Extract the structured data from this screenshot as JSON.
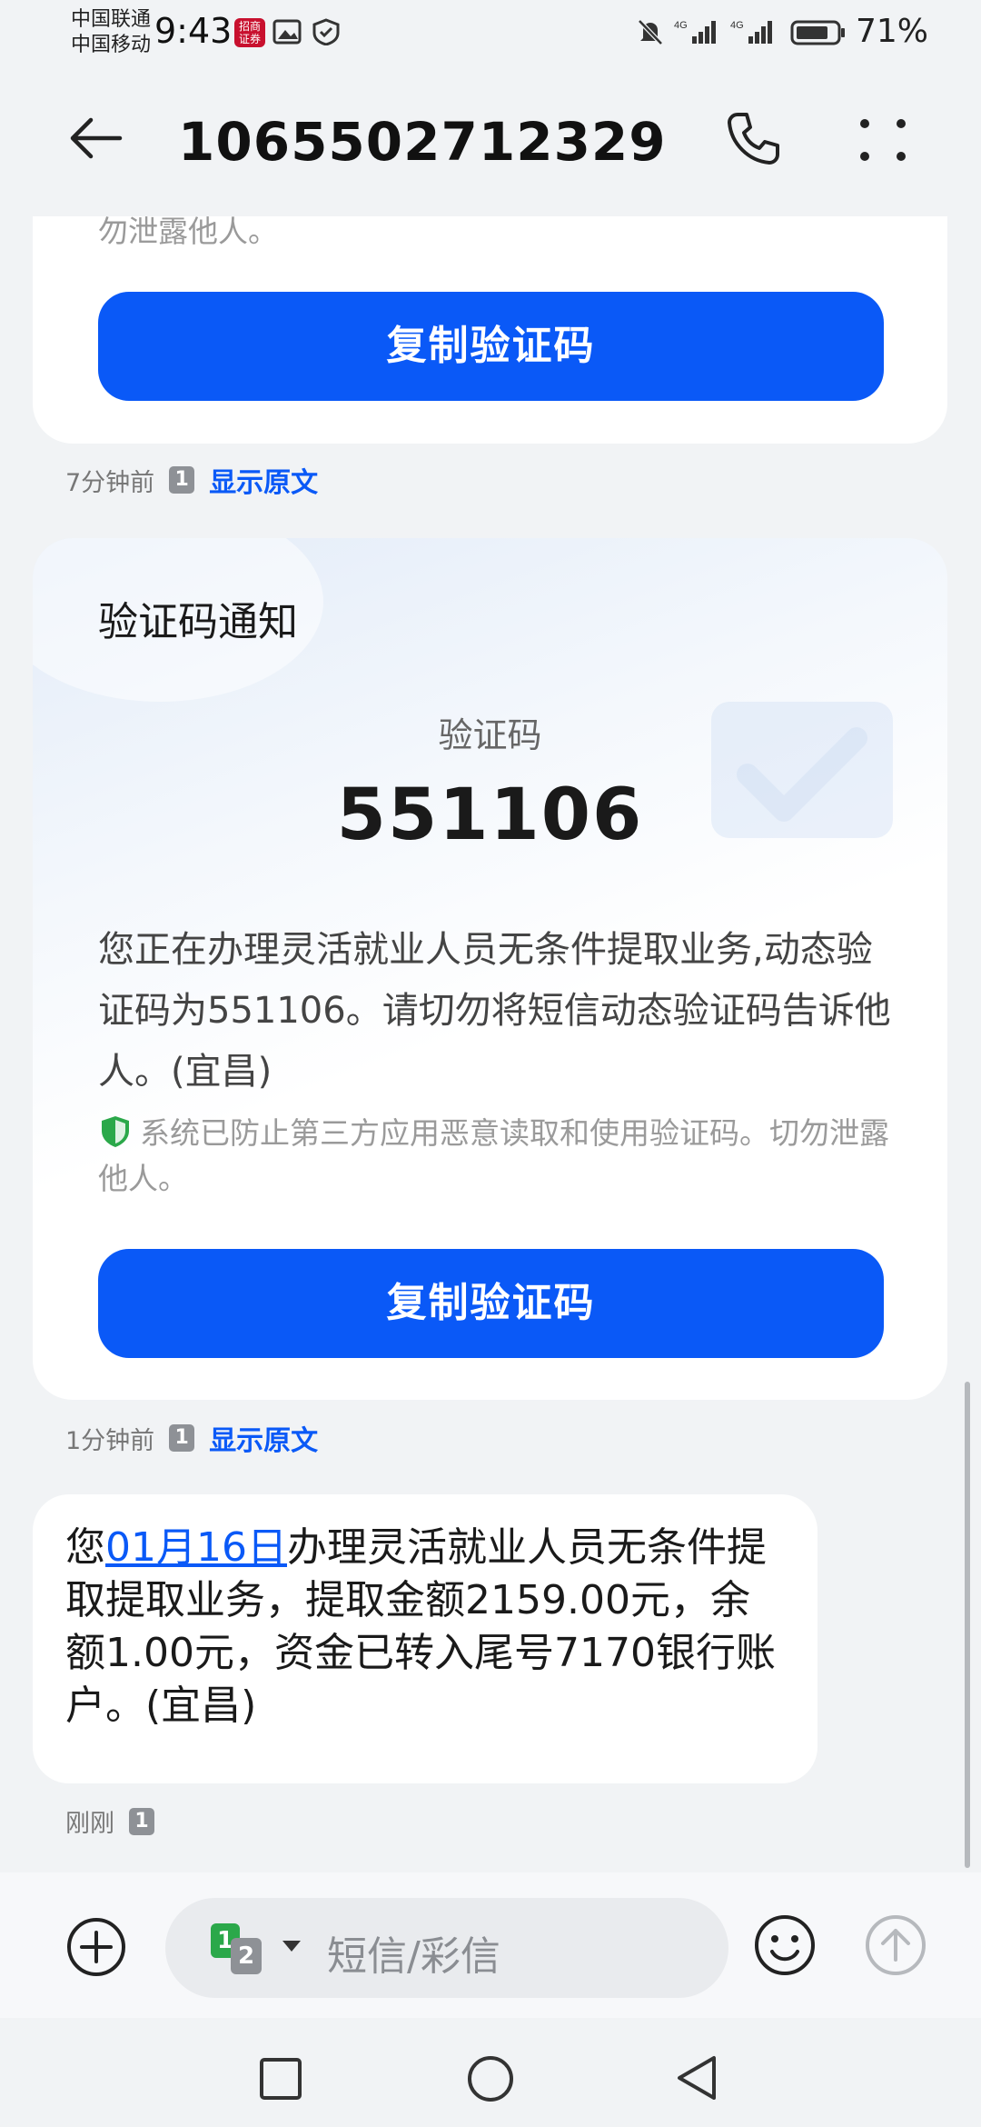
{
  "status_bar": {
    "carrier1": "中国联通",
    "carrier2": "中国移动",
    "time": "9:43",
    "app_badge": "招商证券",
    "signal1": "4G",
    "signal2": "4G",
    "battery": "71%"
  },
  "header": {
    "title": "1065502712329",
    "icons": [
      "back-arrow-icon",
      "phone-icon",
      "more-icon"
    ]
  },
  "messages": [
    {
      "type": "verification_card",
      "hint_tail": "勿泄露他人。",
      "copy_button": "复制验证码",
      "time": "7分钟前",
      "sim": "1",
      "show_original": "显示原文"
    },
    {
      "type": "verification_card",
      "title": "验证码通知",
      "code_label": "验证码",
      "code": "551106",
      "body": "您正在办理灵活就业人员无条件提取业务,动态验证码为551106。请切勿将短信动态验证码告诉他人。(宜昌)",
      "hint": "系统已防止第三方应用恶意读取和使用验证码。切勿泄露他人。",
      "copy_button": "复制验证码",
      "time": "1分钟前",
      "sim": "1",
      "show_original": "显示原文"
    },
    {
      "type": "text",
      "prefix": "您",
      "date_link": "01月16日",
      "body": "办理灵活就业人员无条件提取提取业务，提取金额2159.00元，余额1.00元，资金已转入尾号7170银行账户。(宜昌)",
      "time": "刚刚",
      "sim": "1"
    }
  ],
  "input_bar": {
    "sim_primary": "1",
    "sim_secondary": "2",
    "placeholder": "短信/彩信"
  },
  "colors": {
    "accent": "#0a59f7",
    "background": "#f1f3f5",
    "shield_green": "#2ba84a"
  }
}
